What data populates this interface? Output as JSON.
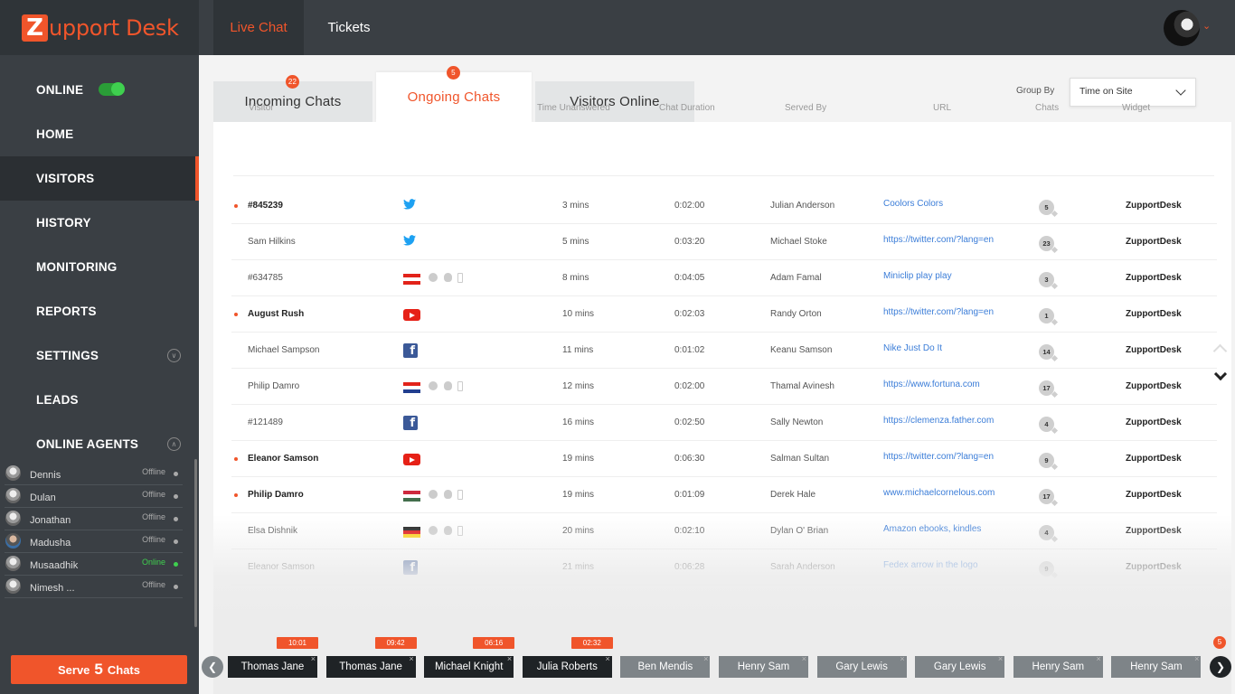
{
  "brand": {
    "logo_letter": "Z",
    "logo_text": "upport Desk"
  },
  "topnav": {
    "live_chat": "Live Chat",
    "tickets": "Tickets"
  },
  "sidebar": {
    "online_label": "ONLINE",
    "items": [
      {
        "label": "HOME"
      },
      {
        "label": "VISITORS"
      },
      {
        "label": "HISTORY"
      },
      {
        "label": "MONITORING"
      },
      {
        "label": "REPORTS"
      },
      {
        "label": "SETTINGS"
      },
      {
        "label": "LEADS"
      },
      {
        "label": "ONLINE AGENTS"
      }
    ],
    "agents": [
      {
        "name": "Dennis",
        "status": "Offline"
      },
      {
        "name": "Dulan",
        "status": "Offline"
      },
      {
        "name": "Jonathan",
        "status": "Offline"
      },
      {
        "name": "Madusha",
        "status": "Offline"
      },
      {
        "name": "Musaadhik",
        "status": "Online"
      },
      {
        "name": "Nimesh ...",
        "status": "Offline"
      }
    ],
    "serve": {
      "prefix": "Serve",
      "count": "5",
      "suffix": "Chats"
    }
  },
  "tabs": [
    {
      "label": "Incoming Chats",
      "badge": "22"
    },
    {
      "label": "Ongoing Chats",
      "badge": "5"
    },
    {
      "label": "Visitors Online",
      "badge": ""
    }
  ],
  "group_by": {
    "label": "Group By",
    "value": "Time on Site"
  },
  "table": {
    "headers": [
      "Visitor",
      "Time Unanswered",
      "Chat Duration",
      "Served By",
      "URL",
      "Chats",
      "Widget"
    ],
    "rows": [
      {
        "visitor": "#845239",
        "new": true,
        "source": "twitter",
        "unanswered": "3 mins",
        "duration": "0:02:00",
        "served_by": "Julian Anderson",
        "url": "Coolors Colors",
        "chats": "5",
        "widget": "ZupportDesk"
      },
      {
        "visitor": "Sam Hilkins",
        "new": false,
        "source": "twitter",
        "unanswered": "5 mins",
        "duration": "0:03:20",
        "served_by": "Michael Stoke",
        "url": "https://twitter.com/?lang=en",
        "chats": "23",
        "widget": "ZupportDesk"
      },
      {
        "visitor": "#634785",
        "new": false,
        "source": "flag-austria",
        "unanswered": "8 mins",
        "duration": "0:04:05",
        "served_by": "Adam Famal",
        "url": "Miniclip play play",
        "chats": "3",
        "widget": "ZupportDesk"
      },
      {
        "visitor": "August Rush",
        "new": true,
        "source": "youtube",
        "unanswered": "10 mins",
        "duration": "0:02:03",
        "served_by": "Randy Orton",
        "url": "https://twitter.com/?lang=en",
        "chats": "1",
        "widget": "ZupportDesk"
      },
      {
        "visitor": "Michael Sampson",
        "new": false,
        "source": "facebook",
        "unanswered": "11 mins",
        "duration": "0:01:02",
        "served_by": "Keanu Samson",
        "url": "Nike Just Do It",
        "chats": "14",
        "widget": "ZupportDesk"
      },
      {
        "visitor": "Philip Damro",
        "new": false,
        "source": "flag-croatia",
        "unanswered": "12 mins",
        "duration": "0:02:00",
        "served_by": "Thamal Avinesh",
        "url": "https://www.fortuna.com",
        "chats": "17",
        "widget": "ZupportDesk"
      },
      {
        "visitor": "#121489",
        "new": false,
        "source": "facebook",
        "unanswered": "16 mins",
        "duration": "0:02:50",
        "served_by": "Sally Newton",
        "url": "https://clemenza.father.com",
        "chats": "4",
        "widget": "ZupportDesk"
      },
      {
        "visitor": "Eleanor Samson",
        "new": true,
        "source": "youtube",
        "unanswered": "19 mins",
        "duration": "0:06:30",
        "served_by": "Salman Sultan",
        "url": "https://twitter.com/?lang=en",
        "chats": "9",
        "widget": "ZupportDesk"
      },
      {
        "visitor": "Philip Damro",
        "new": true,
        "source": "flag-hungary",
        "unanswered": "19 mins",
        "duration": "0:01:09",
        "served_by": "Derek Hale",
        "url": "www.michaelcornelous.com",
        "chats": "17",
        "widget": "ZupportDesk"
      },
      {
        "visitor": "Elsa Dishnik",
        "new": false,
        "source": "flag-germany",
        "unanswered": "20 mins",
        "duration": "0:02:10",
        "served_by": "Dylan O' Brian",
        "url": "Amazon ebooks, kindles",
        "chats": "4",
        "widget": "ZupportDesk"
      },
      {
        "visitor": "Eleanor Samson",
        "new": false,
        "source": "facebook",
        "unanswered": "21 mins",
        "duration": "0:06:28",
        "served_by": "Sarah Anderson",
        "url": "Fedex arrow in the logo",
        "chats": "9",
        "widget": "ZupportDesk"
      }
    ]
  },
  "chat_strip": {
    "badge": "5",
    "chips": [
      {
        "name": "Thomas Jane",
        "time": "10:01",
        "style": "dark"
      },
      {
        "name": "Thomas Jane",
        "time": "09:42",
        "style": "dark"
      },
      {
        "name": "Michael Knight",
        "time": "06:16",
        "style": "dark"
      },
      {
        "name": "Julia Roberts",
        "time": "02:32",
        "style": "dark"
      },
      {
        "name": "Ben Mendis",
        "time": "",
        "style": "grey"
      },
      {
        "name": "Henry Sam",
        "time": "",
        "style": "grey"
      },
      {
        "name": "Gary Lewis",
        "time": "",
        "style": "grey"
      },
      {
        "name": "Gary Lewis",
        "time": "",
        "style": "grey"
      },
      {
        "name": "Henry Sam",
        "time": "",
        "style": "grey"
      },
      {
        "name": "Henry Sam",
        "time": "",
        "style": "grey"
      }
    ]
  },
  "colors": {
    "accent": "#f0552b",
    "sidebar": "#3a3f44",
    "link": "#3b7dd8",
    "online": "#3fd04f"
  }
}
